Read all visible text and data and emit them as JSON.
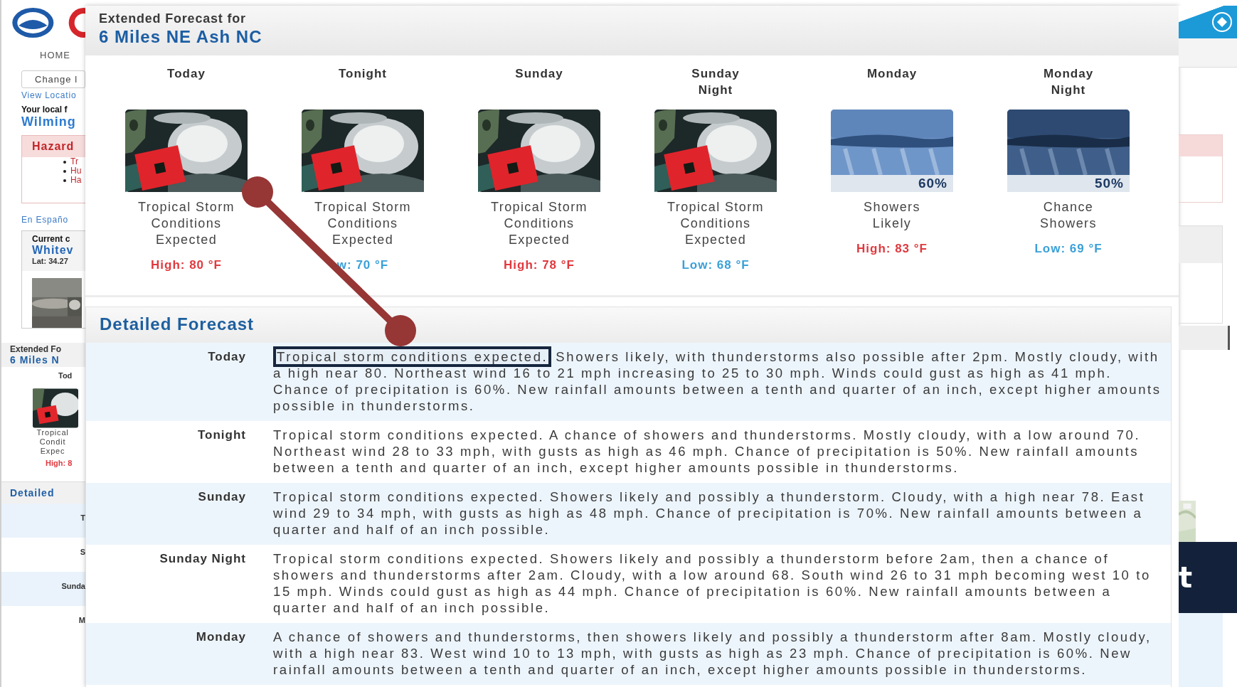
{
  "background_page": {
    "nav": "HOME",
    "location_field": "Change l",
    "view_link": "View Locatio",
    "local_label": "Your local f",
    "office": "Wilming",
    "hazards_title": "Hazard",
    "hazards": [
      "Tr",
      "Hu",
      "Ha"
    ],
    "spanish_link": "En Españo",
    "current_label": "Current c",
    "current_station": "Whitev",
    "latitude": "Lat: 34.27",
    "mini_forecast": {
      "title": "Extended Fo",
      "place": "6 Miles N",
      "period": "Tod",
      "lines": [
        "Tropical",
        "Condit",
        "Expec"
      ],
      "temp": "High: 8"
    },
    "mini_detailed": {
      "title": "Detailed",
      "periods": [
        "T",
        "S",
        "Sunda",
        "M"
      ]
    },
    "banner_fragment": "t"
  },
  "forecast": {
    "title": "Extended Forecast for",
    "location": "6 Miles NE Ash NC",
    "periods": [
      {
        "name": "Today",
        "kind": "storm",
        "summary": [
          "Tropical Storm",
          "Conditions",
          "Expected"
        ],
        "temp": "High: 80 °F",
        "high": true
      },
      {
        "name": "Tonight",
        "kind": "storm",
        "summary": [
          "Tropical Storm",
          "Conditions",
          "Expected"
        ],
        "temp": "w: 70 °F",
        "high": false
      },
      {
        "name": "Sunday",
        "kind": "storm",
        "summary": [
          "Tropical Storm",
          "Conditions",
          "Expected"
        ],
        "temp": "High: 78 °F",
        "high": true
      },
      {
        "name": "Sunday Night",
        "kind": "storm",
        "summary": [
          "Tropical Storm",
          "Conditions",
          "Expected"
        ],
        "temp": "Low: 68 °F",
        "high": false
      },
      {
        "name": "Monday",
        "kind": "rain",
        "chance": "60%",
        "summary": [
          "Showers",
          "Likely"
        ],
        "temp": "High: 83 °F",
        "high": true
      },
      {
        "name": "Monday Night",
        "kind": "nightrain",
        "chance": "50%",
        "summary": [
          "Chance",
          "Showers"
        ],
        "temp": "Low: 69 °F",
        "high": false
      }
    ]
  },
  "detailed": {
    "title": "Detailed Forecast",
    "rows": [
      {
        "period": "Today",
        "highlighted": "Tropical storm conditions expected.",
        "text": "Showers likely, with thunderstorms also possible after 2pm. Mostly cloudy, with a high near 80. Northeast wind 16 to 21 mph increasing to 25 to 30 mph. Winds could gust as high as 41 mph. Chance of precipitation is 60%. New rainfall amounts between a tenth and quarter of an inch, except higher amounts possible in thunderstorms."
      },
      {
        "period": "Tonight",
        "text": "Tropical storm conditions expected. A chance of showers and thunderstorms. Mostly cloudy, with a low around 70. Northeast wind 28 to 33 mph, with gusts as high as 46 mph. Chance of precipitation is 50%. New rainfall amounts between a tenth and quarter of an inch, except higher amounts possible in thunderstorms."
      },
      {
        "period": "Sunday",
        "text": "Tropical storm conditions expected. Showers likely and possibly a thunderstorm. Cloudy, with a high near 78. East wind 29 to 34 mph, with gusts as high as 48 mph. Chance of precipitation is 70%. New rainfall amounts between a quarter and half of an inch possible."
      },
      {
        "period": "Sunday Night",
        "text": "Tropical storm conditions expected. Showers likely and possibly a thunderstorm before 2am, then a chance of showers and thunderstorms after 2am. Cloudy, with a low around 68. South wind 26 to 31 mph becoming west 10 to 15 mph. Winds could gust as high as 44 mph. Chance of precipitation is 60%. New rainfall amounts between a quarter and half of an inch possible."
      },
      {
        "period": "Monday",
        "text": "A chance of showers and thunderstorms, then showers likely and possibly a thunderstorm after 8am. Mostly cloudy, with a high near 83. West wind 10 to 13 mph, with gusts as high as 23 mph. Chance of precipitation is 60%. New rainfall amounts between a tenth and quarter of an inch, except higher amounts possible in thunderstorms."
      }
    ]
  }
}
